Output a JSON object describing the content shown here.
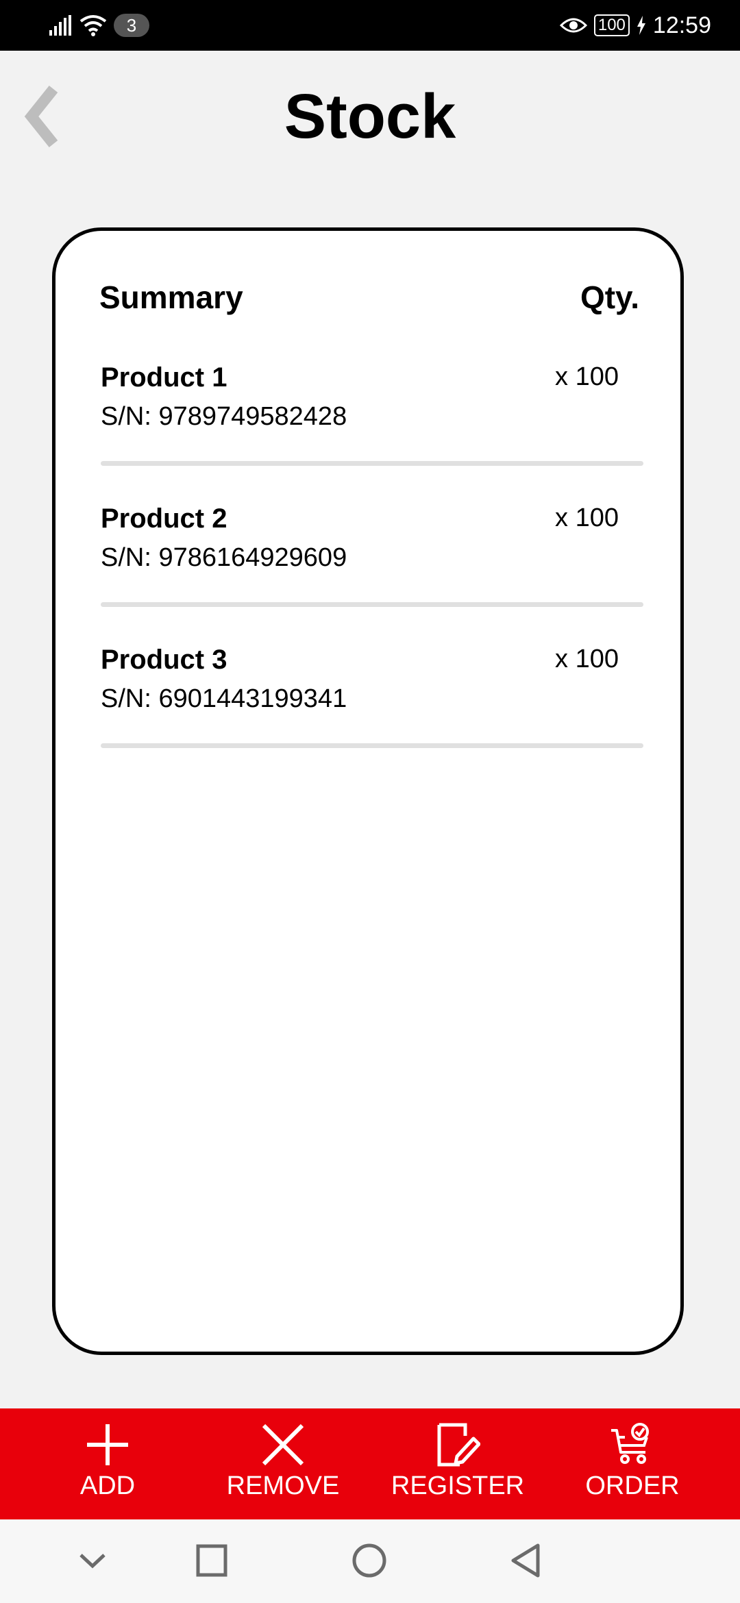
{
  "status_bar": {
    "notification_count": "3",
    "battery": "100",
    "time": "12:59",
    "icons": [
      "signal-icon",
      "wifi-icon",
      "eye-icon",
      "battery-icon",
      "charging-icon"
    ]
  },
  "header": {
    "title": "Stock",
    "back_icon": "chevron-left-icon"
  },
  "summary": {
    "heading": "Summary",
    "qty_heading": "Qty.",
    "items": [
      {
        "name": "Product 1",
        "serial": "S/N: 9789749582428",
        "qty": "x 100"
      },
      {
        "name": "Product 2",
        "serial": "S/N: 9786164929609",
        "qty": "x 100"
      },
      {
        "name": "Product 3",
        "serial": "S/N: 6901443199341",
        "qty": "x 100"
      }
    ]
  },
  "actions": [
    {
      "label": "ADD",
      "icon": "plus-icon"
    },
    {
      "label": "REMOVE",
      "icon": "close-icon"
    },
    {
      "label": "REGISTER",
      "icon": "edit-document-icon"
    },
    {
      "label": "ORDER",
      "icon": "cart-check-icon"
    }
  ],
  "colors": {
    "accent": "#e8000b",
    "background": "#f2f2f2",
    "card": "#ffffff",
    "divider": "#e0e0e0"
  },
  "nav_bar": {
    "icons": [
      "chevron-down-icon",
      "square-icon",
      "circle-icon",
      "triangle-back-icon"
    ]
  }
}
